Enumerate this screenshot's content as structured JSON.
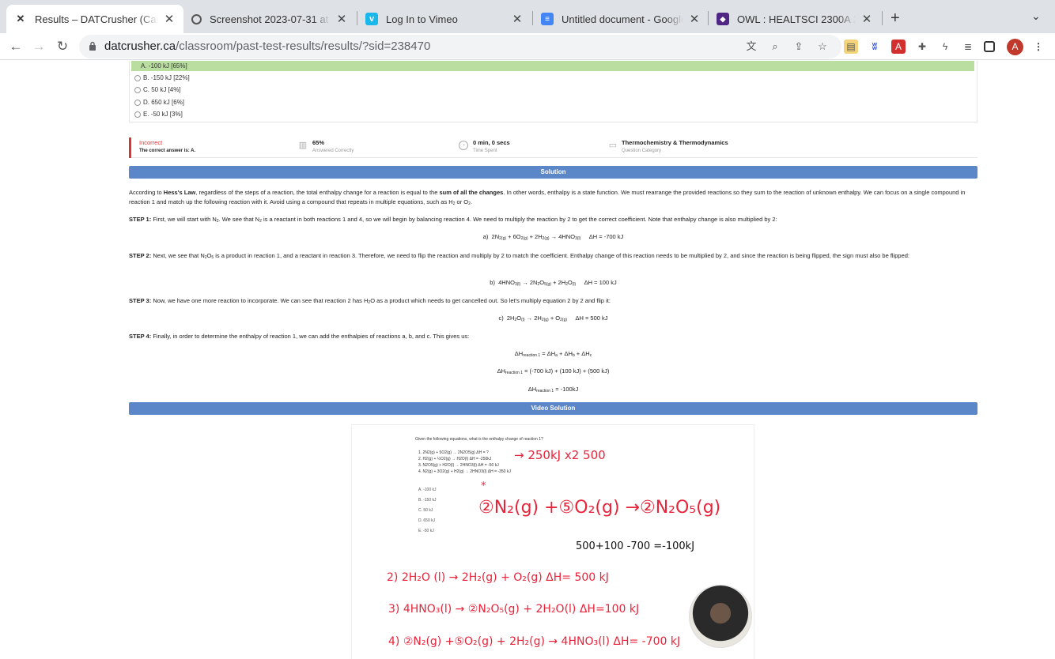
{
  "tabs": [
    {
      "title": "Results – DATCrusher (Canadian",
      "icon": "datcrusher-icon",
      "active": true
    },
    {
      "title": "Screenshot 2023-07-31 at 5.0",
      "icon": "globe-icon"
    },
    {
      "title": "Log In to Vimeo",
      "icon": "vimeo-icon"
    },
    {
      "title": "Untitled document - Google Do",
      "icon": "google-docs-icon"
    },
    {
      "title": "OWL : HEALTSCI 2300A 200 S",
      "icon": "owl-icon"
    }
  ],
  "address": {
    "host": "datcrusher.ca",
    "path": "/classroom/past-test-results/results/?sid=238470"
  },
  "profile_initial": "A",
  "answers": [
    {
      "text": "A. -100 kJ [65%]",
      "correct": true
    },
    {
      "text": "B. -150 kJ [22%]"
    },
    {
      "text": "C. 50 kJ [4%]"
    },
    {
      "text": "D. 650 kJ [6%]"
    },
    {
      "text": "E. -50 kJ [3%]"
    }
  ],
  "stats": {
    "status": "Incorrect",
    "correct_answer": "The correct answer is: A.",
    "percent": "65%",
    "percent_label": "Answered Correctly",
    "time": "0 min, 0 secs",
    "time_label": "Time Spent",
    "category": "Thermochemistry & Thermodynamics",
    "category_label": "Question Category"
  },
  "solution_header": "Solution",
  "video_header": "Video Solution",
  "solution": {
    "intro_1": "According to ",
    "intro_law": "Hess's Law",
    "intro_2": ", regardless of the steps of a reaction, the total enthalpy change for a reaction is equal to the ",
    "intro_sum": "sum of all the changes",
    "intro_3": ". In other words, enthalpy is a state function. We must rearrange the provided reactions so they sum to the reaction of unknown enthalpy. We can focus on a single compound in reaction 1 and match up the following reaction with it. Avoid using a compound that repeats in multiple equations, such as H",
    "intro_4": " or O",
    "step1_label": "STEP 1:",
    "step1": "First, we will start with N",
    "step1_b": ". We see that N",
    "step1_c": " is a reactant in both reactions 1 and 4, so we will begin by balancing reaction 4. We need to multiply the reaction by 2 to get the correct coefficient. Note that enthalpy change is also multiplied by 2:",
    "eq_a_dh": "ΔH = -700 kJ",
    "step2_label": "STEP 2:",
    "step2_a": "Next, we see that N",
    "step2_b": " is a product in reaction 1, and a reactant in reaction 3. Therefore, we need to flip the reaction and multiply by 2 to match the coefficient. Enthalpy change of this reaction needs to be multiplied by 2, and since the reaction is being flipped, the sign must also be flipped:",
    "eq_b_dh": "ΔH = 100 kJ",
    "step3_label": "STEP 3:",
    "step3": "Now, we have one more reaction to incorporate. We can see that reaction 2 has H",
    "step3_b": "O as a product which needs to get cancelled out. So let's multiply equation 2 by 2 and flip it:",
    "eq_c_dh": "ΔH = 500 kJ",
    "step4_label": "STEP 4:",
    "step4": "Finally, in order to determine the enthalpy of reaction 1, we can add the enthalpies of reactions a, b, and c. This gives us:",
    "eq_sum_2": "= (-700 kJ) + (100 kJ) + (500 kJ)",
    "eq_sum_3": "= -100kJ"
  },
  "video": {
    "question": "Given the following equations, what is the enthalpy change of reaction 1?",
    "lines": [
      "1. 2N2(g) + 5O2(g) → 2N2O5(g)     ΔH = ?",
      "2. H2(g) + ½O2(g) → H2O(l)     ΔH = -250kJ",
      "3. N2O5(g) + H2O(l) → 2HNO3(l)     ΔH = -50 kJ",
      "4. N2(g) + 3O2(g) + H2(g) → 2HNO3(l)     ΔH = -350 kJ"
    ],
    "options": [
      "A. -100 kJ",
      "B. -150 kJ",
      "C. 50 kJ",
      "D. 650 kJ",
      "E. -50 kJ"
    ],
    "ink_1": "→ 250kJ x2  500",
    "ink_2": "②N₂(g) +⑤O₂(g) →②N₂O₅(g)",
    "ink_3": "500+100 -700 =-100kJ",
    "ink_4": "2) 2H₂O (l) → 2H₂(g) + O₂(g)         ΔH= 500 kJ",
    "ink_5": "3) 4HNO₃(l) → ②N₂O₅(g) + 2H₂O(l)    ΔH=100 kJ",
    "ink_6": "4) ②N₂(g) +⑤O₂(g) + 2H₂(g) → 4HNO₃(l)  ΔH= -700 kJ"
  }
}
